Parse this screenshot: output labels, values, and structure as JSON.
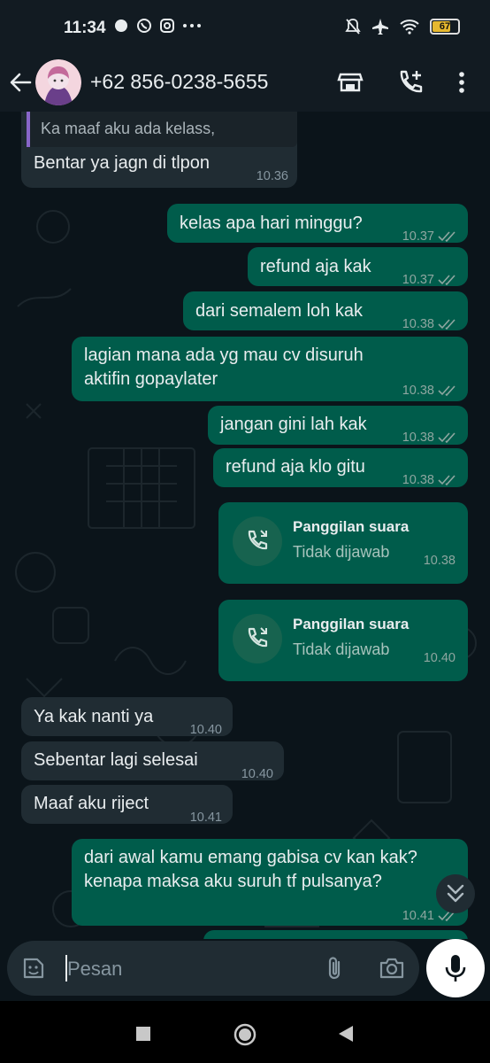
{
  "status_bar": {
    "time": "11:34",
    "battery": "67"
  },
  "header": {
    "contact_name": "+62 856-0238-5655"
  },
  "messages": [
    {
      "dir": "in",
      "quoted_text": "Ka maaf aku ada  kelass,",
      "text": "Bentar ya jagn di tlpon",
      "time": "10.36"
    },
    {
      "dir": "out",
      "text": "kelas apa hari minggu?",
      "time": "10.37"
    },
    {
      "dir": "out",
      "text": "refund aja kak",
      "time": "10.37"
    },
    {
      "dir": "out",
      "text": "dari semalem loh kak",
      "time": "10.38"
    },
    {
      "dir": "out",
      "text": "lagian mana ada yg mau cv disuruh aktifin gopaylater",
      "time": "10.38"
    },
    {
      "dir": "out",
      "text": "jangan gini lah kak",
      "time": "10.38"
    },
    {
      "dir": "out",
      "text": "refund aja klo gitu",
      "time": "10.38"
    },
    {
      "dir": "out",
      "type": "call",
      "title": "Panggilan suara",
      "subtitle": "Tidak dijawab",
      "time": "10.38"
    },
    {
      "dir": "out",
      "type": "call",
      "title": "Panggilan suara",
      "subtitle": "Tidak dijawab",
      "time": "10.40"
    },
    {
      "dir": "in",
      "text": "Ya kak nanti ya",
      "time": "10.40"
    },
    {
      "dir": "in",
      "text": "Sebentar lagi selesai",
      "time": "10.40"
    },
    {
      "dir": "in",
      "text": "Maaf aku riject",
      "time": "10.41"
    },
    {
      "dir": "out",
      "text": "dari awal kamu emang gabisa cv kan kak? kenapa maksa aku suruh tf pulsanya?",
      "time": "10.41"
    }
  ],
  "composer": {
    "placeholder": "Pesan"
  },
  "icons": {
    "back": "arrow-left-icon",
    "shop": "store-icon",
    "add_call": "phone-plus-icon",
    "menu": "more-vert-icon",
    "sticker": "sticker-icon",
    "attach": "paperclip-icon",
    "camera": "camera-icon",
    "mic": "mic-icon",
    "scroll": "chevrons-down-icon"
  },
  "colors": {
    "incoming": "#202c33",
    "outgoing": "#005c4b",
    "background": "#0b141a",
    "accent": "#53bdeb"
  }
}
